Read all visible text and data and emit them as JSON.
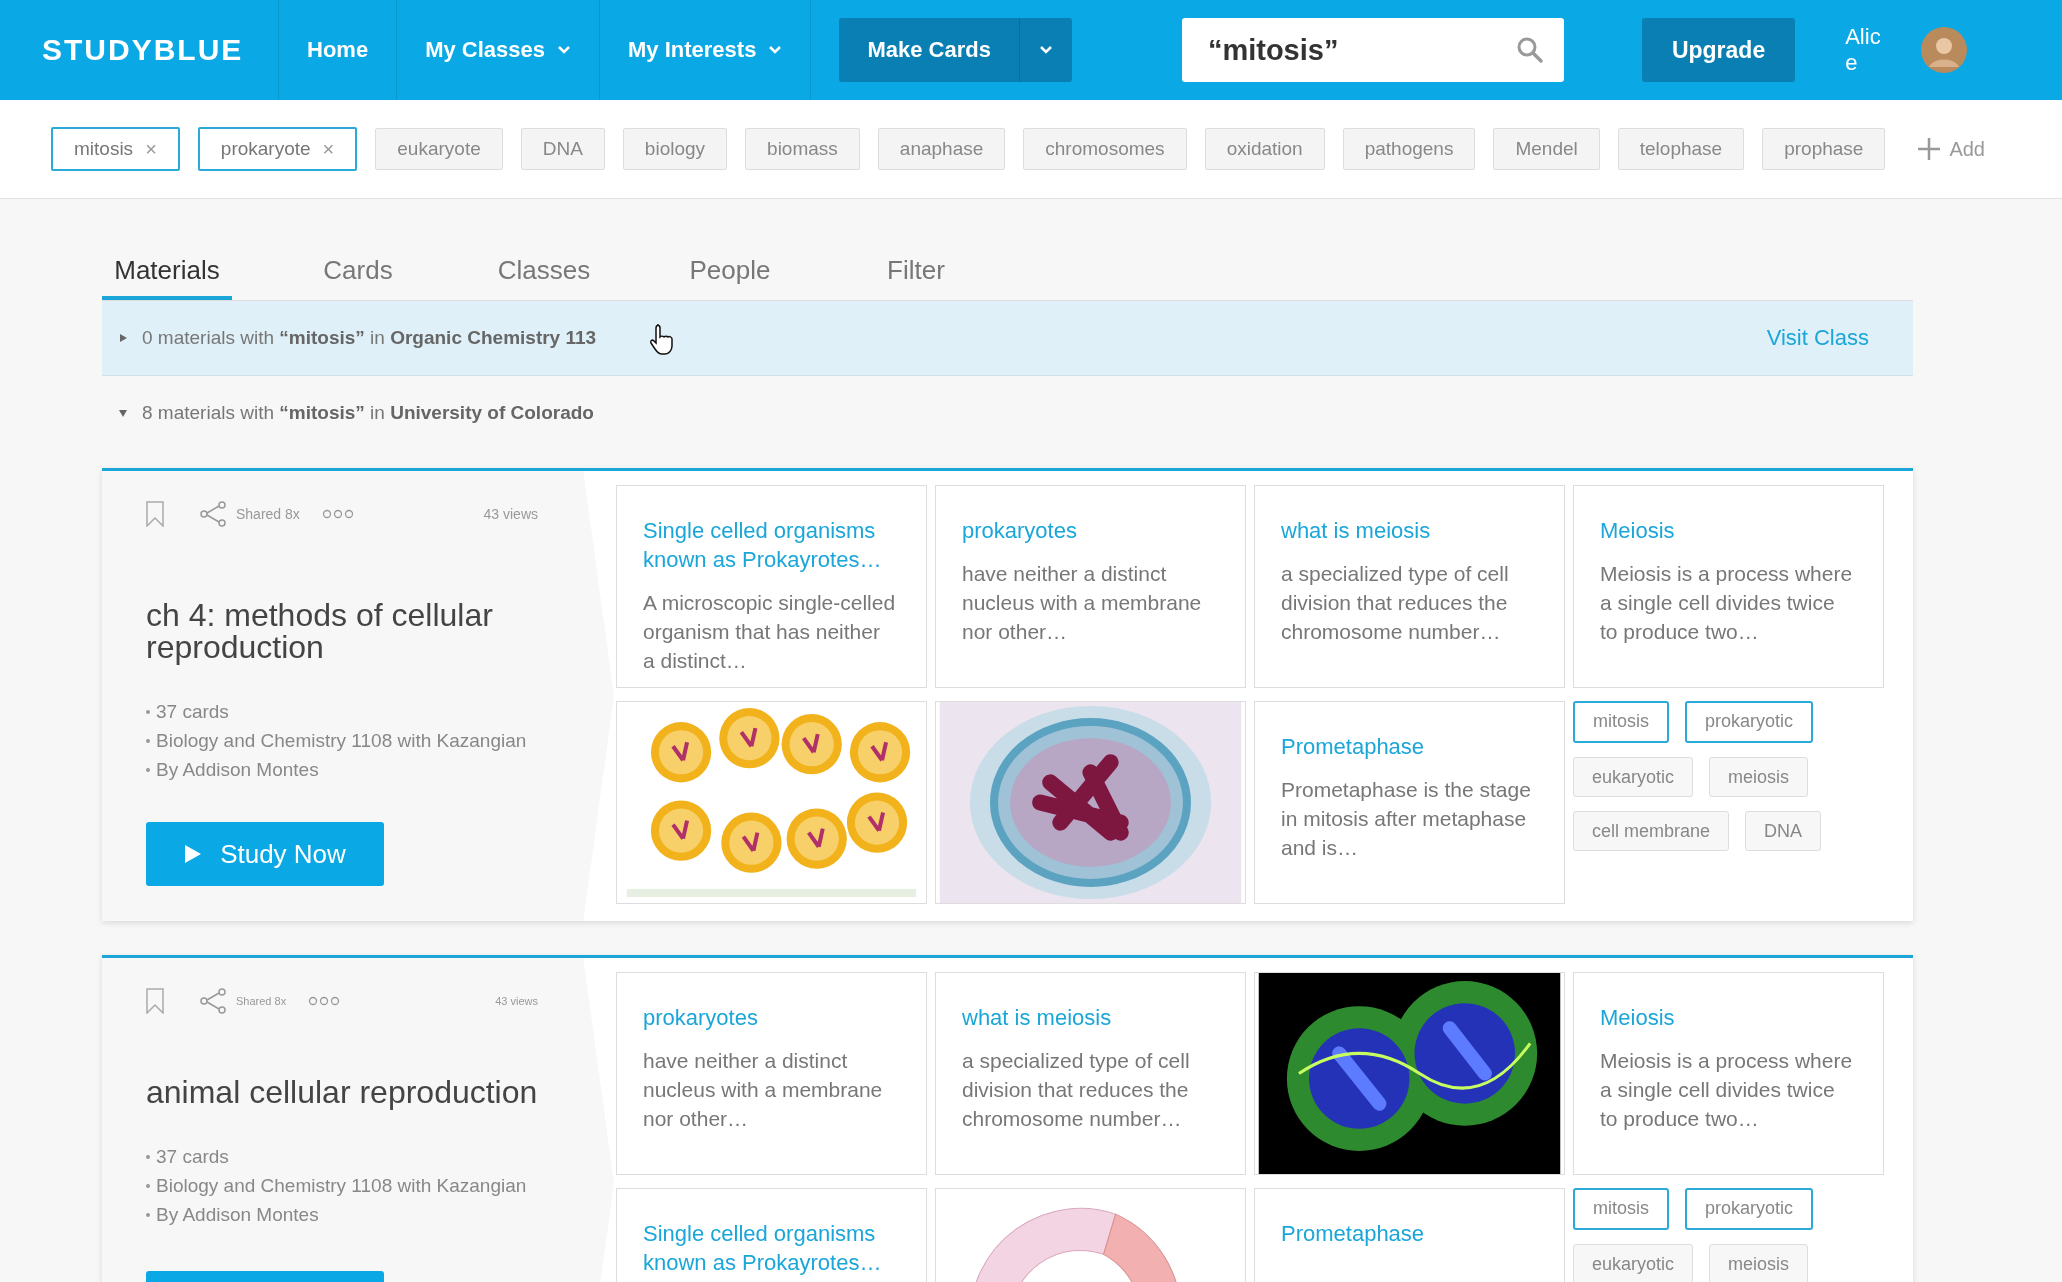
{
  "header": {
    "logo": "STUDYBLUE",
    "nav": [
      {
        "label": "Home",
        "dropdown": false
      },
      {
        "label": "My Classes",
        "dropdown": true
      },
      {
        "label": "My Interests",
        "dropdown": true
      }
    ],
    "make_cards": "Make Cards",
    "search": {
      "value": "“mitosis”"
    },
    "upgrade": "Upgrade",
    "user": "Alice"
  },
  "tag_filters": [
    {
      "label": "mitosis",
      "selected": true,
      "remove": "×"
    },
    {
      "label": "prokaryote",
      "selected": true,
      "remove": "×"
    },
    {
      "label": "eukaryote",
      "selected": false
    },
    {
      "label": "DNA",
      "selected": false
    },
    {
      "label": "biology",
      "selected": false
    },
    {
      "label": "biomass",
      "selected": false
    },
    {
      "label": "anaphase",
      "selected": false
    },
    {
      "label": "chromosomes",
      "selected": false
    },
    {
      "label": "oxidation",
      "selected": false
    },
    {
      "label": "pathogens",
      "selected": false
    },
    {
      "label": "Mendel",
      "selected": false
    },
    {
      "label": "telophase",
      "selected": false
    },
    {
      "label": "prophase",
      "selected": false
    }
  ],
  "add_tag": "Add",
  "tabs": [
    {
      "label": "Materials",
      "selected": true
    },
    {
      "label": "Cards",
      "selected": false
    },
    {
      "label": "Classes",
      "selected": false
    },
    {
      "label": "People",
      "selected": false
    },
    {
      "label": "Filter",
      "selected": false
    }
  ],
  "groups": [
    {
      "text": "0 materials with **“mitosis”** in **Organic Chemistry 113**",
      "expanded": false,
      "highlighted": true,
      "action": "Visit Class"
    },
    {
      "text": "8 materials with **“mitosis”** in **University of Colorado**",
      "expanded": true,
      "highlighted": false
    }
  ],
  "materials": [
    {
      "shared": "Shared 8x",
      "views": "43 views",
      "title": "ch 4: methods of cellular reproduction",
      "meta": [
        "37 cards",
        "Biology and Chemistry 1108 with Kazangian",
        "By Addison Montes"
      ],
      "study": "Study Now",
      "compact": false,
      "tiles": [
        {
          "kind": "card",
          "term": "Single celled organisms known as Prokayrotes…",
          "definition": "A microscopic single-celled organism that has neither a distinct…"
        },
        {
          "kind": "card",
          "term": "prokaryotes",
          "definition": "have neither a distinct nucleus with a membrane nor other…"
        },
        {
          "kind": "card",
          "term": "what is meiosis",
          "definition": "a specialized type of cell division that reduces the chromosome number…"
        },
        {
          "kind": "card",
          "term": "Meiosis",
          "definition": "Meiosis is a process where a single cell divides twice to produce two…"
        },
        {
          "kind": "picture"
        },
        {
          "kind": "picture"
        },
        {
          "kind": "card",
          "term": "Prometaphase",
          "definition": "Prometaphase is the stage in mitosis after metaphase and is…"
        },
        {
          "kind": "tags",
          "tags": [
            {
              "label": "mitosis",
              "selected": true
            },
            {
              "label": "prokaryotic",
              "selected": true
            },
            {
              "label": "eukaryotic",
              "selected": false
            },
            {
              "label": "meiosis",
              "selected": false
            },
            {
              "label": "cell membrane",
              "selected": false
            },
            {
              "label": "DNA",
              "selected": false
            }
          ]
        }
      ]
    },
    {
      "shared": "Shared 8x",
      "views": "43 views",
      "title": "animal cellular reproduction",
      "meta": [
        "37 cards",
        "Biology and Chemistry 1108 with Kazangian",
        "By Addison Montes"
      ],
      "compact": true,
      "tiles": [
        {
          "kind": "card",
          "term": "prokaryotes",
          "definition": "have neither a distinct nucleus with a membrane nor other…"
        },
        {
          "kind": "card",
          "term": "what is meiosis",
          "definition": "a specialized type of cell division that reduces the chromosome number…"
        },
        {
          "kind": "picture"
        },
        {
          "kind": "card",
          "term": "Meiosis",
          "definition": "Meiosis is a process where a single cell divides twice to produce two…"
        },
        {
          "kind": "card",
          "term": "Single celled organisms known as Prokayrotes…"
        },
        {
          "kind": "picture"
        },
        {
          "kind": "card",
          "term": "Prometaphase"
        },
        {
          "kind": "tags",
          "tags": [
            {
              "label": "mitosis",
              "selected": true
            },
            {
              "label": "prokaryotic",
              "selected": true
            },
            {
              "label": "eukaryotic",
              "selected": false
            },
            {
              "label": "meiosis",
              "selected": false
            }
          ]
        }
      ]
    }
  ]
}
